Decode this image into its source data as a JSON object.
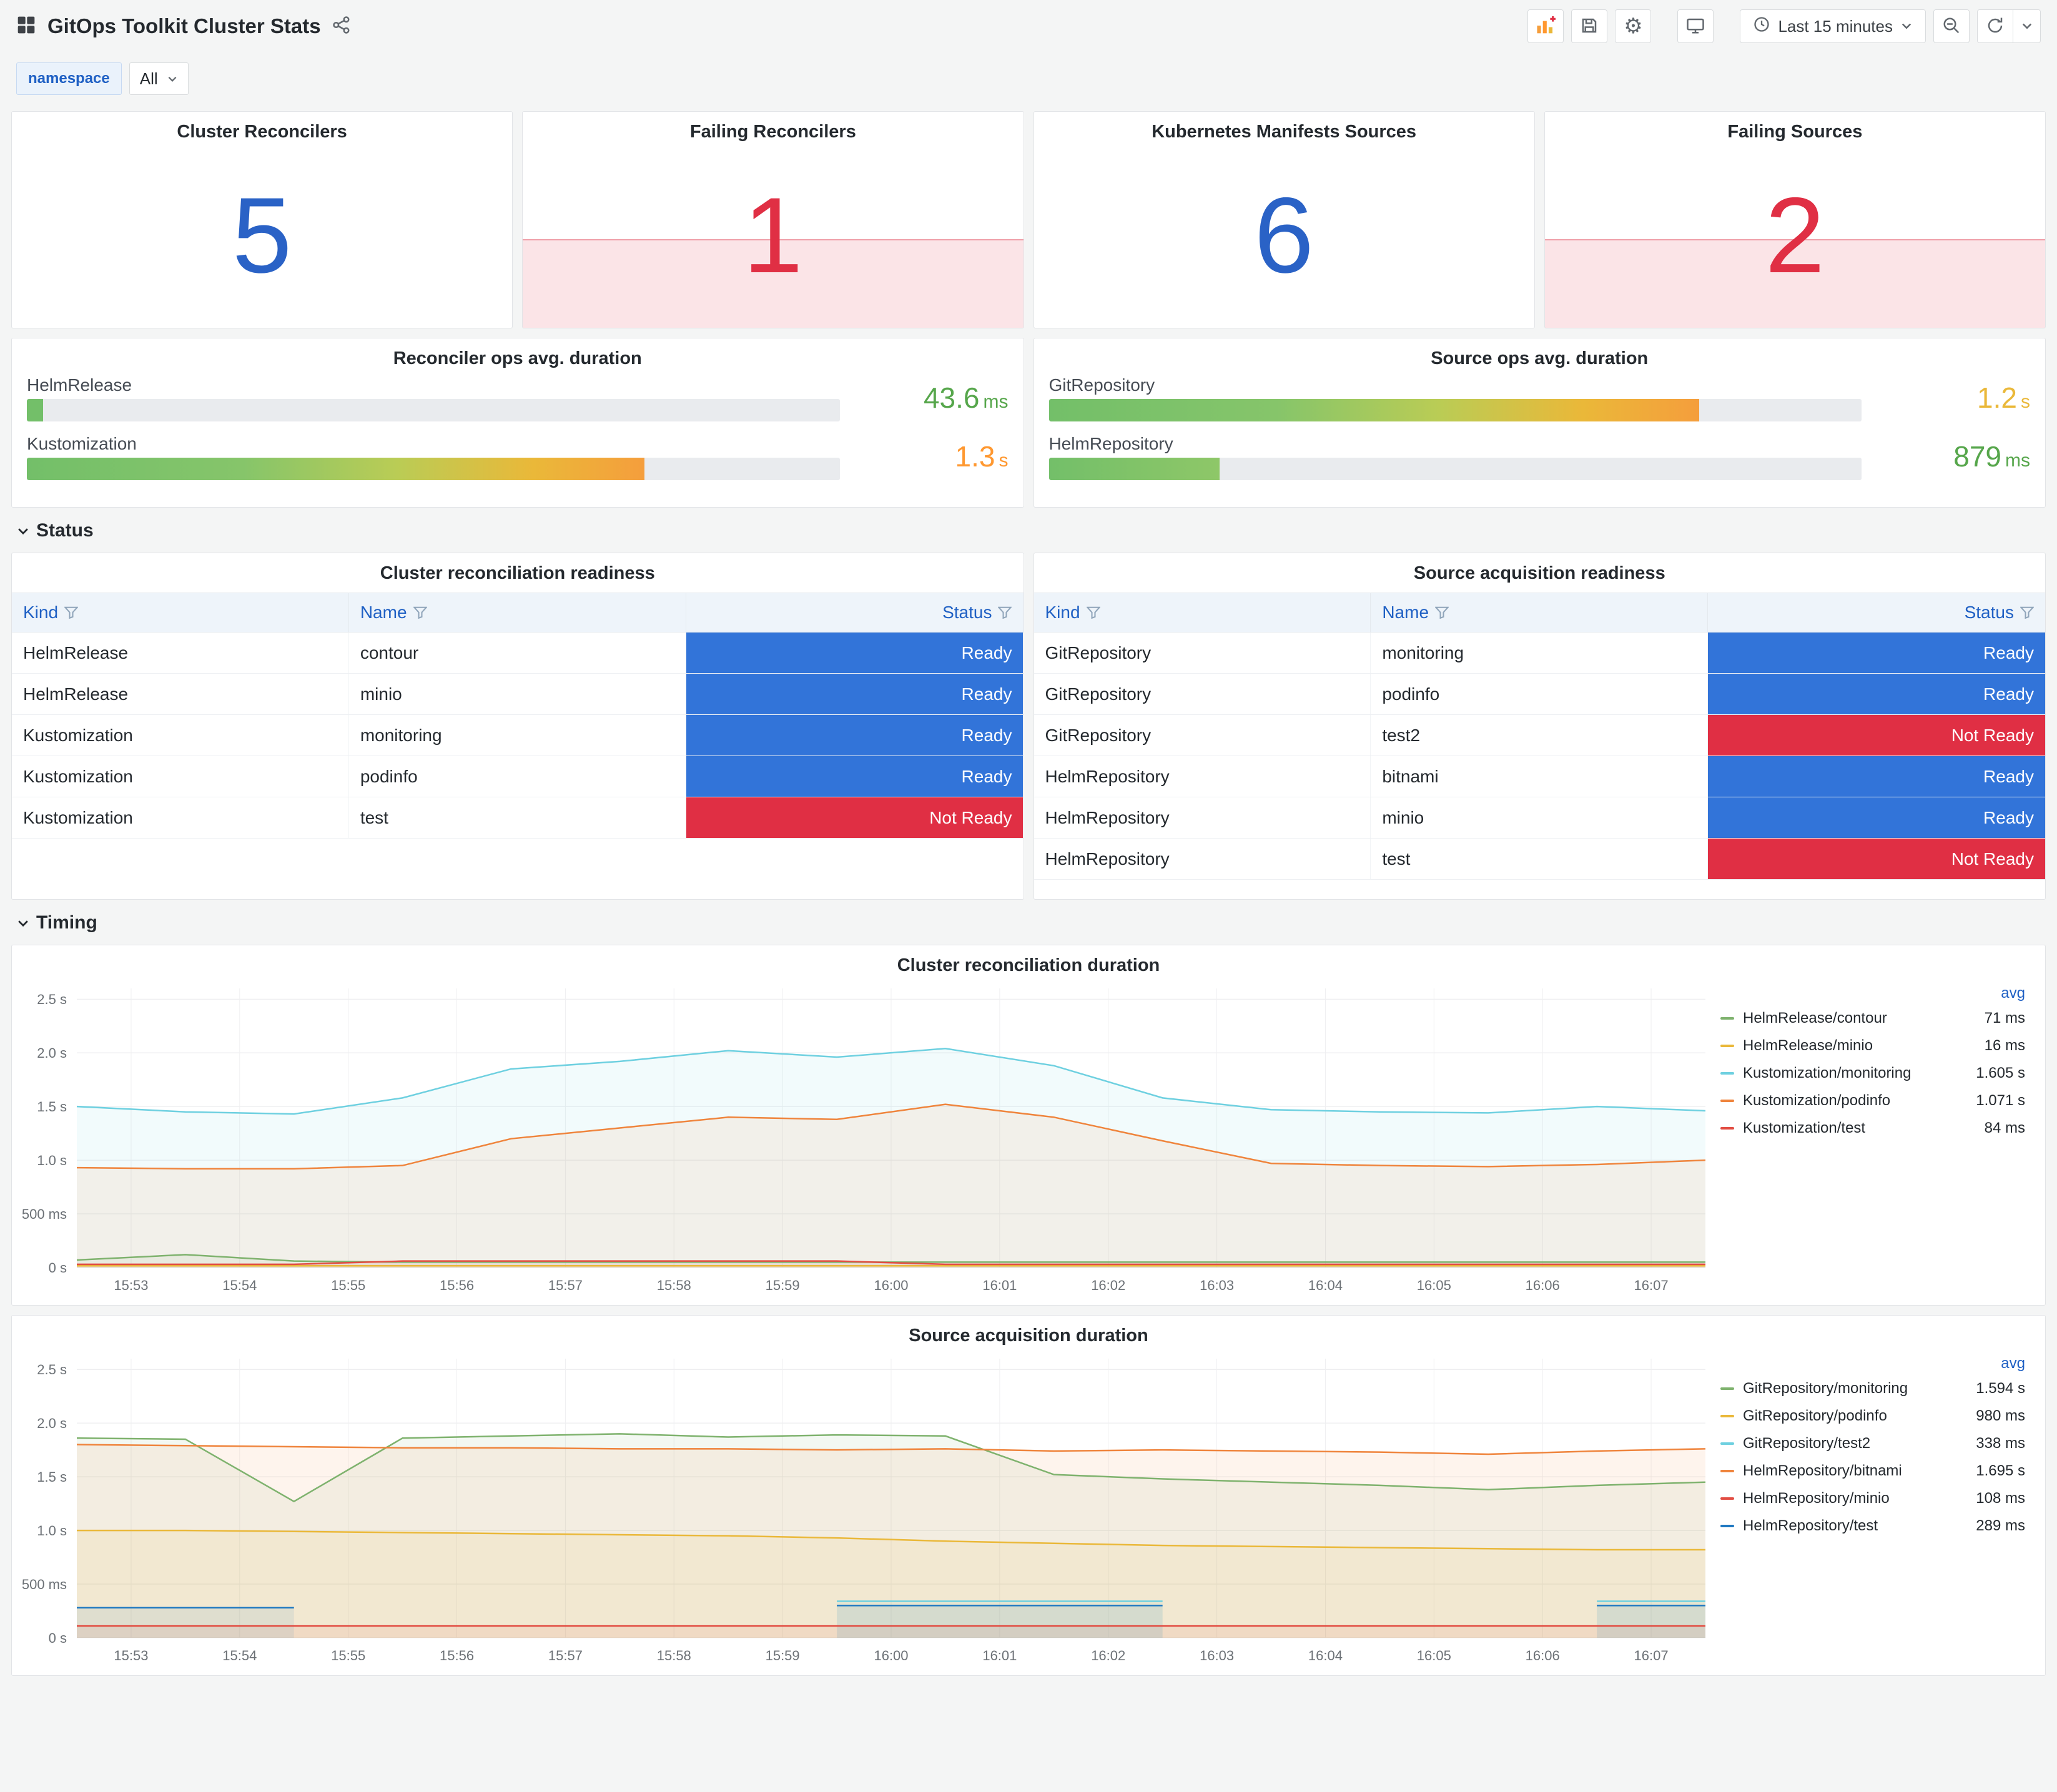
{
  "header": {
    "title": "GitOps Toolkit Cluster Stats",
    "time_range": "Last 15 minutes"
  },
  "variables": {
    "label": "namespace",
    "value": "All"
  },
  "sections": {
    "status": "Status",
    "timing": "Timing"
  },
  "stats": [
    {
      "title": "Cluster Reconcilers",
      "value": "5",
      "state": "ok"
    },
    {
      "title": "Failing Reconcilers",
      "value": "1",
      "state": "alert"
    },
    {
      "title": "Kubernetes Manifests Sources",
      "value": "6",
      "state": "ok"
    },
    {
      "title": "Failing Sources",
      "value": "2",
      "state": "alert"
    }
  ],
  "gauge_panels": [
    {
      "title": "Reconciler ops avg. duration",
      "rows": [
        {
          "label": "HelmRelease",
          "value": "43.6",
          "unit": "ms",
          "pct": 2,
          "bar": "green",
          "value_color": "#56A64B"
        },
        {
          "label": "Kustomization",
          "value": "1.3",
          "unit": "s",
          "pct": 76,
          "bar": "gradient",
          "value_color": "#FF9830"
        }
      ]
    },
    {
      "title": "Source ops avg. duration",
      "rows": [
        {
          "label": "GitRepository",
          "value": "1.2",
          "unit": "s",
          "pct": 80,
          "bar": "gradient",
          "value_color": "#EAB839"
        },
        {
          "label": "HelmRepository",
          "value": "879",
          "unit": "ms",
          "pct": 21,
          "bar": "green2",
          "value_color": "#56A64B"
        }
      ]
    }
  ],
  "tables": [
    {
      "title": "Cluster reconciliation readiness",
      "columns": [
        "Kind",
        "Name",
        "Status"
      ],
      "rows": [
        [
          "HelmRelease",
          "contour",
          "Ready"
        ],
        [
          "HelmRelease",
          "minio",
          "Ready"
        ],
        [
          "Kustomization",
          "monitoring",
          "Ready"
        ],
        [
          "Kustomization",
          "podinfo",
          "Ready"
        ],
        [
          "Kustomization",
          "test",
          "Not Ready"
        ]
      ]
    },
    {
      "title": "Source acquisition readiness",
      "columns": [
        "Kind",
        "Name",
        "Status"
      ],
      "rows": [
        [
          "GitRepository",
          "monitoring",
          "Ready"
        ],
        [
          "GitRepository",
          "podinfo",
          "Ready"
        ],
        [
          "GitRepository",
          "test2",
          "Not Ready"
        ],
        [
          "HelmRepository",
          "bitnami",
          "Ready"
        ],
        [
          "HelmRepository",
          "minio",
          "Ready"
        ],
        [
          "HelmRepository",
          "test",
          "Not Ready"
        ]
      ]
    }
  ],
  "chart_data": [
    {
      "type": "line",
      "title": "Cluster reconciliation duration",
      "legend_value_header": "avg",
      "legend_position": "right",
      "grid": true,
      "ylim": [
        0,
        2.6
      ],
      "y_ticks": [
        {
          "v": 0,
          "label": "0 s"
        },
        {
          "v": 0.5,
          "label": "500 ms"
        },
        {
          "v": 1,
          "label": "1.0 s"
        },
        {
          "v": 1.5,
          "label": "1.5 s"
        },
        {
          "v": 2,
          "label": "2.0 s"
        },
        {
          "v": 2.5,
          "label": "2.5 s"
        }
      ],
      "x_ticks": [
        "15:53",
        "15:54",
        "15:55",
        "15:56",
        "15:57",
        "15:58",
        "15:59",
        "16:00",
        "16:01",
        "16:02",
        "16:03",
        "16:04",
        "16:05",
        "16:06",
        "16:07"
      ],
      "series": [
        {
          "name": "HelmRelease/contour",
          "avg": "71 ms",
          "color": "#7EB26D",
          "values": [
            0.07,
            0.12,
            0.06,
            0.05,
            0.05,
            0.05,
            0.05,
            0.05,
            0.05,
            0.05,
            0.05,
            0.05,
            0.05,
            0.05,
            0.05,
            0.05
          ]
        },
        {
          "name": "HelmRelease/minio",
          "avg": "16 ms",
          "color": "#EAB839",
          "values": [
            0.016,
            0.016,
            0.016,
            0.016,
            0.016,
            0.016,
            0.016,
            0.016,
            0.016,
            0.016,
            0.016,
            0.016,
            0.016,
            0.016,
            0.016,
            0.016
          ]
        },
        {
          "name": "Kustomization/monitoring",
          "avg": "1.605 s",
          "color": "#6ED0E0",
          "values": [
            1.5,
            1.45,
            1.43,
            1.58,
            1.85,
            1.92,
            2.02,
            1.96,
            2.04,
            1.88,
            1.58,
            1.47,
            1.45,
            1.44,
            1.5,
            1.46
          ]
        },
        {
          "name": "Kustomization/podinfo",
          "avg": "1.071 s",
          "color": "#EF843C",
          "values": [
            0.93,
            0.92,
            0.92,
            0.95,
            1.2,
            1.3,
            1.4,
            1.38,
            1.52,
            1.4,
            1.18,
            0.97,
            0.95,
            0.94,
            0.96,
            1.0
          ]
        },
        {
          "name": "Kustomization/test",
          "avg": "84 ms",
          "color": "#E24D42",
          "values": [
            0.03,
            0.03,
            0.03,
            0.06,
            0.06,
            0.06,
            0.06,
            0.06,
            0.03,
            0.03,
            0.03,
            0.03,
            0.03,
            0.03,
            0.03,
            0.03
          ]
        }
      ]
    },
    {
      "type": "line",
      "title": "Source acquisition duration",
      "legend_value_header": "avg",
      "legend_position": "right",
      "grid": true,
      "ylim": [
        0,
        2.6
      ],
      "y_ticks": [
        {
          "v": 0,
          "label": "0 s"
        },
        {
          "v": 0.5,
          "label": "500 ms"
        },
        {
          "v": 1,
          "label": "1.0 s"
        },
        {
          "v": 1.5,
          "label": "1.5 s"
        },
        {
          "v": 2,
          "label": "2.0 s"
        },
        {
          "v": 2.5,
          "label": "2.5 s"
        }
      ],
      "x_ticks": [
        "15:53",
        "15:54",
        "15:55",
        "15:56",
        "15:57",
        "15:58",
        "15:59",
        "16:00",
        "16:01",
        "16:02",
        "16:03",
        "16:04",
        "16:05",
        "16:06",
        "16:07"
      ],
      "series": [
        {
          "name": "GitRepository/monitoring",
          "avg": "1.594 s",
          "color": "#7EB26D",
          "values": [
            1.86,
            1.85,
            1.27,
            1.86,
            1.88,
            1.9,
            1.87,
            1.89,
            1.88,
            1.52,
            1.48,
            1.45,
            1.42,
            1.38,
            1.42,
            1.45
          ]
        },
        {
          "name": "GitRepository/podinfo",
          "avg": "980 ms",
          "color": "#EAB839",
          "values": [
            1.0,
            1.0,
            0.99,
            0.98,
            0.97,
            0.96,
            0.95,
            0.93,
            0.9,
            0.88,
            0.86,
            0.85,
            0.84,
            0.83,
            0.82,
            0.82
          ]
        },
        {
          "name": "GitRepository/test2",
          "avg": "338 ms",
          "color": "#6ED0E0",
          "values": [
            null,
            null,
            null,
            null,
            null,
            null,
            null,
            0.34,
            0.34,
            0.34,
            0.34,
            null,
            null,
            null,
            0.34,
            0.34
          ]
        },
        {
          "name": "HelmRepository/bitnami",
          "avg": "1.695 s",
          "color": "#EF843C",
          "values": [
            1.8,
            1.79,
            1.78,
            1.77,
            1.77,
            1.76,
            1.76,
            1.75,
            1.76,
            1.74,
            1.75,
            1.74,
            1.73,
            1.71,
            1.74,
            1.76
          ]
        },
        {
          "name": "HelmRepository/minio",
          "avg": "108 ms",
          "color": "#E24D42",
          "values": [
            0.11,
            0.11,
            0.11,
            0.11,
            0.11,
            0.11,
            0.11,
            0.11,
            0.11,
            0.11,
            0.11,
            0.11,
            0.11,
            0.11,
            0.11,
            0.11
          ]
        },
        {
          "name": "HelmRepository/test",
          "avg": "289 ms",
          "color": "#1F78C1",
          "values": [
            0.28,
            0.28,
            0.28,
            null,
            null,
            null,
            null,
            0.3,
            0.3,
            0.3,
            0.3,
            null,
            null,
            null,
            0.3,
            0.3
          ]
        }
      ]
    }
  ]
}
